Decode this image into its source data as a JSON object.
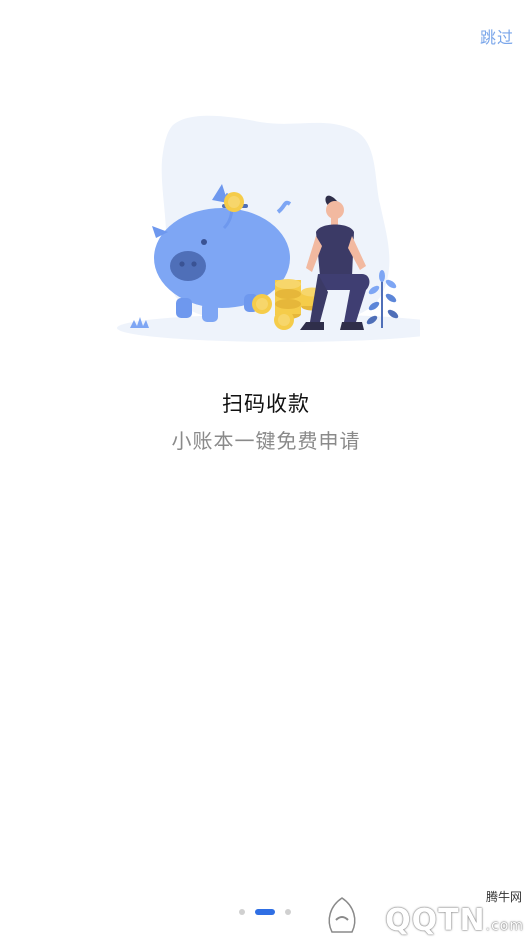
{
  "header": {
    "skip_label": "跳过"
  },
  "slide": {
    "title": "扫码收款",
    "subtitle": "小账本一键免费申请",
    "illustration_icon": "piggy-bank-with-person-illustration"
  },
  "pager": {
    "total": 3,
    "active_index": 1
  },
  "watermark": {
    "cn_label": "腾牛网",
    "en_label": "QQTN",
    "suffix": ".com"
  },
  "colors": {
    "accent": "#2f6fe4",
    "skip_text": "#7aa6ea",
    "pig": "#7ea6f4",
    "coin": "#f5cc4a",
    "blob": "#eef3fb"
  }
}
